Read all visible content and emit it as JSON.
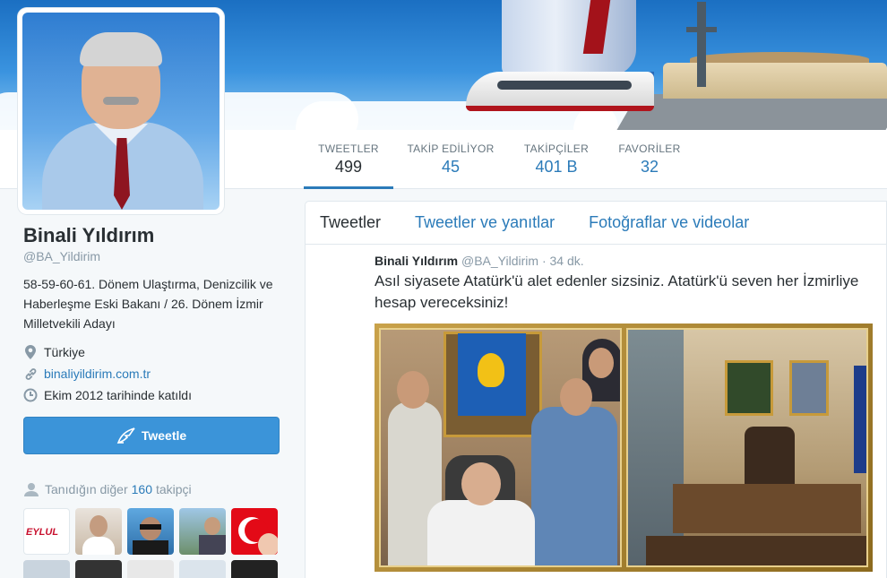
{
  "profile": {
    "name": "Binali Yıldırım",
    "handle": "@BA_Yildirim",
    "bio": "58-59-60-61. Dönem Ulaştırma, Denizcilik ve Haberleşme Eski Bakanı / 26. Dönem İzmir Milletvekili Adayı",
    "location": "Türkiye",
    "website": "binaliyildirim.com.tr",
    "joined": "Ekim 2012 tarihinde katıldı",
    "tweet_button": "Tweetle",
    "followers_you_know_prefix": "Tanıdığın diğer",
    "followers_you_know_count": "160",
    "followers_you_know_suffix": "takipçi",
    "thumb_badge_text": "EYLUL"
  },
  "stats": [
    {
      "label": "TWEETLER",
      "value": "499"
    },
    {
      "label": "TAKİP EDİLİYOR",
      "value": "45"
    },
    {
      "label": "TAKİPÇİLER",
      "value": "401 B"
    },
    {
      "label": "FAVORİLER",
      "value": "32"
    }
  ],
  "tabs": [
    {
      "label": "Tweetler"
    },
    {
      "label": "Tweetler ve yanıtlar"
    },
    {
      "label": "Fotoğraflar ve videolar"
    }
  ],
  "tweet": {
    "name": "Binali Yıldırım",
    "handle": "@BA_Yildirim",
    "separator": "·",
    "time": "34 dk.",
    "text": "Asıl siyasete Atatürk'ü alet edenler sizsiniz. Atatürk'ü seven her İzmirliye hesap vereceksiniz!"
  },
  "colors": {
    "link": "#2b7bb9",
    "button": "#3b94d9",
    "text": "#292f33",
    "muted": "#8899a6"
  }
}
